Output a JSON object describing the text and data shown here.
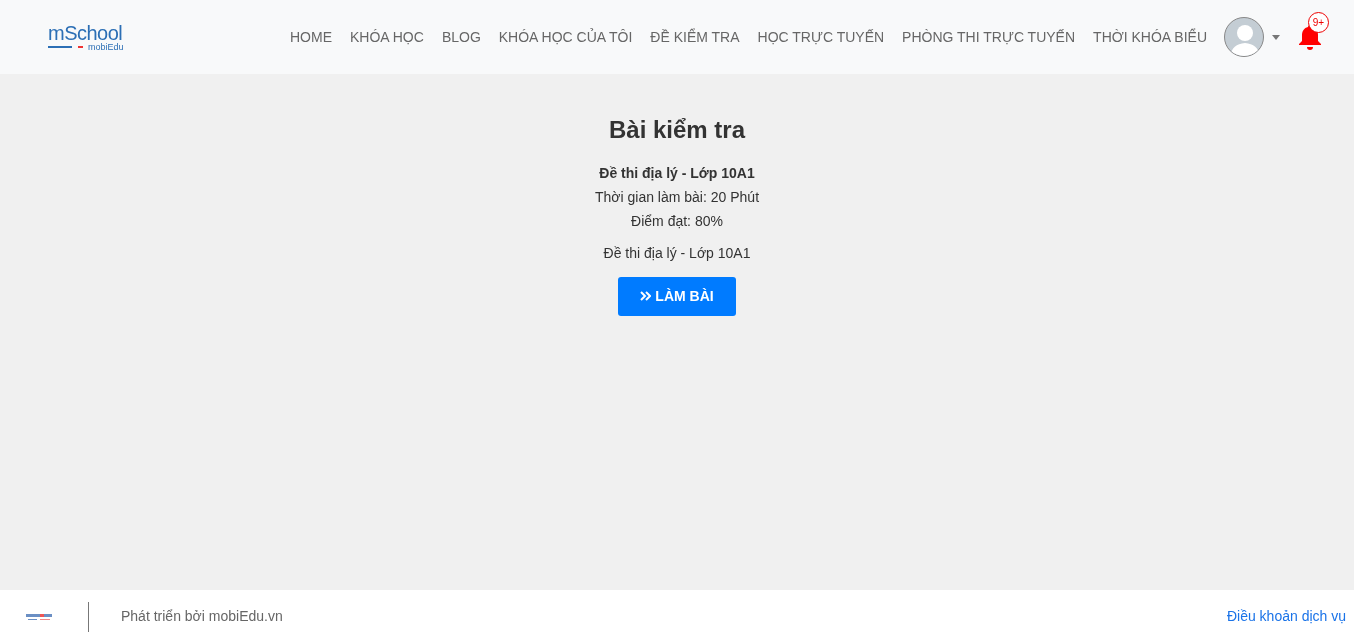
{
  "navbar": {
    "logo": {
      "title": "mSchool",
      "subtitle": "mobiEdu"
    },
    "menu": [
      "HOME",
      "KHÓA HỌC",
      "BLOG",
      "KHÓA HỌC CỦA TÔI",
      "ĐỀ KIỂM TRA",
      "HỌC TRỰC TUYẾN",
      "PHÒNG THI TRỰC TUYẾN",
      "THỜI KHÓA BIỂU"
    ],
    "notifications": {
      "count": "9+"
    }
  },
  "test": {
    "heading": "Bài kiểm tra",
    "name": "Đề thi địa lý - Lớp 10A1",
    "duration": "Thời gian làm bài: 20 Phút",
    "pass_score": "Điểm đạt: 80%",
    "description": "Đề thi địa lý - Lớp 10A1",
    "button": "LÀM BÀI"
  },
  "footer": {
    "credit": "Phát triển bởi mobiEdu.vn",
    "terms_link": "Điều khoản dịch vụ"
  }
}
